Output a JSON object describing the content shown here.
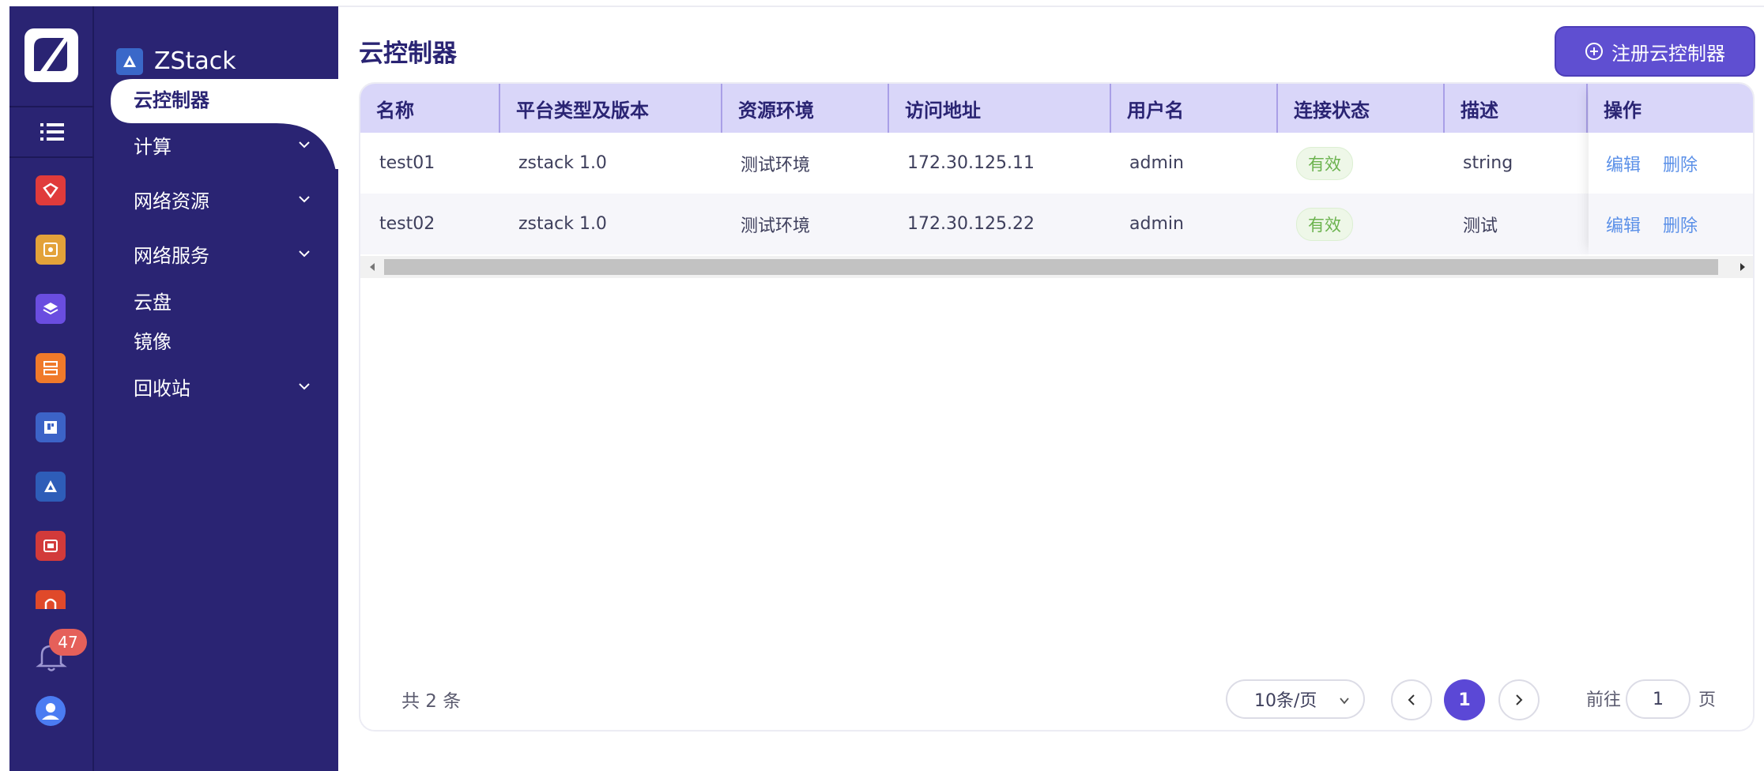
{
  "rail": {
    "logo": "zstack-cloud-logo",
    "apps": [
      {
        "name": "app-red-icon",
        "color": "#e03b3b"
      },
      {
        "name": "app-yellow-icon",
        "color": "#e3a23a"
      },
      {
        "name": "app-purple-icon",
        "color": "#6a4de0"
      },
      {
        "name": "app-orange-icon",
        "color": "#f07a2a"
      },
      {
        "name": "app-blue-icon",
        "color": "#3c63c7"
      },
      {
        "name": "app-zstack-icon",
        "color": "#2e5db8"
      },
      {
        "name": "app-darkred-icon",
        "color": "#d23a3a"
      },
      {
        "name": "app-orange2-icon",
        "color": "#e0492a"
      }
    ],
    "notification_count": "47"
  },
  "nav": {
    "brand": "ZStack",
    "items": [
      {
        "label": "云控制器",
        "active": true,
        "expandable": false
      },
      {
        "label": "计算",
        "active": false,
        "expandable": true
      },
      {
        "label": "网络资源",
        "active": false,
        "expandable": true
      },
      {
        "label": "网络服务",
        "active": false,
        "expandable": true
      },
      {
        "label": "云盘",
        "active": false,
        "expandable": false
      },
      {
        "label": "镜像",
        "active": false,
        "expandable": false
      },
      {
        "label": "回收站",
        "active": false,
        "expandable": true
      }
    ]
  },
  "main": {
    "title": "云控制器",
    "register_button": "注册云控制器",
    "columns": [
      "名称",
      "平台类型及版本",
      "资源环境",
      "访问地址",
      "用户名",
      "连接状态",
      "描述",
      "操作"
    ],
    "rows": [
      {
        "name": "test01",
        "platform": "zstack 1.0",
        "env": "测试环境",
        "address": "172.30.125.11",
        "user": "admin",
        "status": "有效",
        "desc": "string"
      },
      {
        "name": "test02",
        "platform": "zstack 1.0",
        "env": "测试环境",
        "address": "172.30.125.22",
        "user": "admin",
        "status": "有效",
        "desc": "测试"
      }
    ],
    "ops": {
      "edit": "编辑",
      "delete": "删除"
    },
    "pagination": {
      "total": "共 2 条",
      "page_size": "10条/页",
      "current_page": "1",
      "goto_label": "前往",
      "goto_value": "1",
      "goto_suffix": "页"
    }
  },
  "colors": {
    "sidebar": "#2a2473",
    "accent": "#5b48d6",
    "header": "#d9d6f9",
    "link": "#5b90e8",
    "status_ok": "#6cb34f"
  }
}
